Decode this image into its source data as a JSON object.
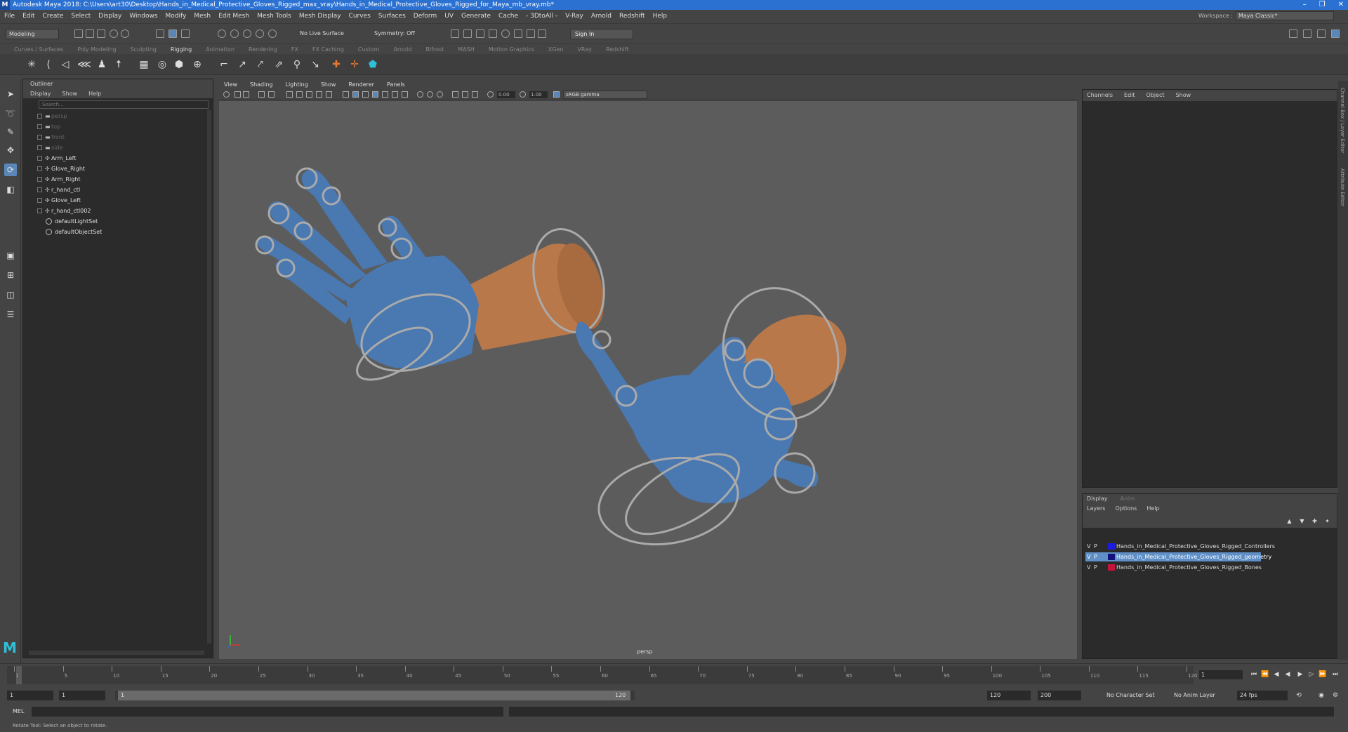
{
  "window": {
    "title": "Autodesk Maya 2018: C:\\Users\\art30\\Desktop\\Hands_in_Medical_Protective_Gloves_Rigged_max_vray\\Hands_in_Medical_Protective_Gloves_Rigged_for_Maya_mb_vray.mb*",
    "controls": [
      "–",
      "❐",
      "✕"
    ]
  },
  "menubar": {
    "items": [
      "File",
      "Edit",
      "Create",
      "Select",
      "Display",
      "Windows",
      "Modify",
      "Mesh",
      "Edit Mesh",
      "Mesh Tools",
      "Mesh Display",
      "Curves",
      "Surfaces",
      "Deform",
      "UV",
      "Generate",
      "Cache",
      "- 3DtoAll -",
      "V-Ray",
      "Arnold",
      "Redshift",
      "Help"
    ],
    "workspace_label": "Workspace :",
    "workspace_value": "Maya Classic*"
  },
  "statusline": {
    "mode": "Modeling",
    "live_surface": "No Live Surface",
    "symmetry": "Symmetry: Off",
    "sign_in": "Sign In"
  },
  "shelf": {
    "tabs": [
      "Curves / Surfaces",
      "Poly Modeling",
      "Sculpting",
      "Rigging",
      "Animation",
      "Rendering",
      "FX",
      "FX Caching",
      "Custom",
      "Arnold",
      "Bifrost",
      "MASH",
      "Motion Graphics",
      "XGen",
      "VRay",
      "Redshift"
    ],
    "active_tab": "Rigging"
  },
  "outliner": {
    "title": "Outliner",
    "menu": [
      "Display",
      "Show",
      "Help"
    ],
    "search_placeholder": "Search...",
    "cameras": [
      "persp",
      "top",
      "front",
      "side"
    ],
    "nodes": [
      "Arm_Left",
      "Glove_Right",
      "Arm_Right",
      "r_hand_ctl",
      "Glove_Left",
      "r_hand_ctl002"
    ],
    "sets": [
      "defaultLightSet",
      "defaultObjectSet"
    ]
  },
  "viewport": {
    "menu": [
      "View",
      "Shading",
      "Lighting",
      "Show",
      "Renderer",
      "Panels"
    ],
    "exposure": "0.00",
    "gamma": "1.00",
    "color_space": "sRGB gamma",
    "camera": "persp"
  },
  "channelbox": {
    "menu": [
      "Channels",
      "Edit",
      "Object",
      "Show"
    ]
  },
  "layer_editor": {
    "tabs": [
      "Display",
      "Anim"
    ],
    "menu": [
      "Layers",
      "Options",
      "Help"
    ],
    "layers": [
      {
        "v": "V",
        "p": "P",
        "color": "#1c1ce0",
        "name": "Hands_in_Medical_Protective_Gloves_Rigged_Controllers"
      },
      {
        "v": "V",
        "p": "P",
        "color": "#12127a",
        "name": "Hands_in_Medical_Protective_Gloves_Rigged_geometry"
      },
      {
        "v": "V",
        "p": "P",
        "color": "#c8143c",
        "name": "Hands_in_Medical_Protective_Gloves_Rigged_Bones"
      }
    ]
  },
  "right_strip": {
    "labels": [
      "Channel Box / Layer Editor",
      "Attribute Editor"
    ]
  },
  "timeslider": {
    "ticks": [
      "1",
      "5",
      "10",
      "15",
      "20",
      "25",
      "30",
      "35",
      "40",
      "45",
      "50",
      "55",
      "60",
      "65",
      "70",
      "75",
      "80",
      "85",
      "90",
      "95",
      "100",
      "105",
      "110",
      "115",
      "120"
    ],
    "current_frame": "1"
  },
  "rangeslider": {
    "start": "1",
    "anim_start": "1",
    "handle_start": "1",
    "handle_end": "120",
    "range_end": "120",
    "anim_end": "200",
    "character_set": "No Character Set",
    "anim_layer": "No Anim Layer",
    "fps": "24 fps"
  },
  "cmdline": {
    "label": "MEL"
  },
  "helpline": {
    "text": "Rotate Tool: Select an object to rotate."
  },
  "colors": {
    "glove": "#4a78b0",
    "skin": "#b8784a",
    "viewport_bg": "#5c5c5c",
    "selection": "#5e8fc6",
    "title_bar": "#2b71d2"
  }
}
